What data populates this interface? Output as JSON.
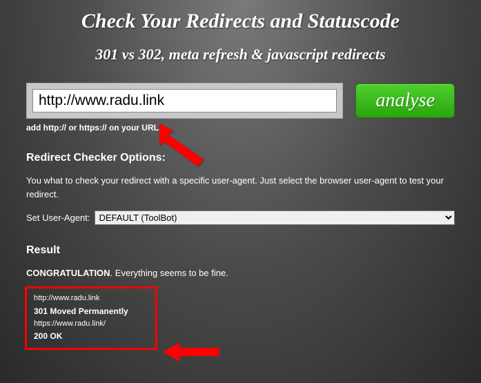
{
  "title": "Check Your Redirects and Statuscode",
  "subtitle": "301 vs 302, meta refresh & javascript redirects",
  "input": {
    "url_value": "http://www.radu.link",
    "hint": "add http:// or https:// on your URL."
  },
  "analyse_label": "analyse",
  "options": {
    "heading": "Redirect Checker Options:",
    "description": "You what to check your redirect with a specific user-agent. Just select the browser user-agent to test your redirect.",
    "ua_label": "Set User-Agent:",
    "ua_selected": "DEFAULT (ToolBot)"
  },
  "result": {
    "heading": "Result",
    "congrat_bold": "CONGRATULATION",
    "congrat_rest": ". Everything seems to be fine.",
    "line1": "http://www.radu.link",
    "line2": "301 Moved Permanently",
    "line3": "https://www.radu.link/",
    "line4": "200 OK"
  }
}
